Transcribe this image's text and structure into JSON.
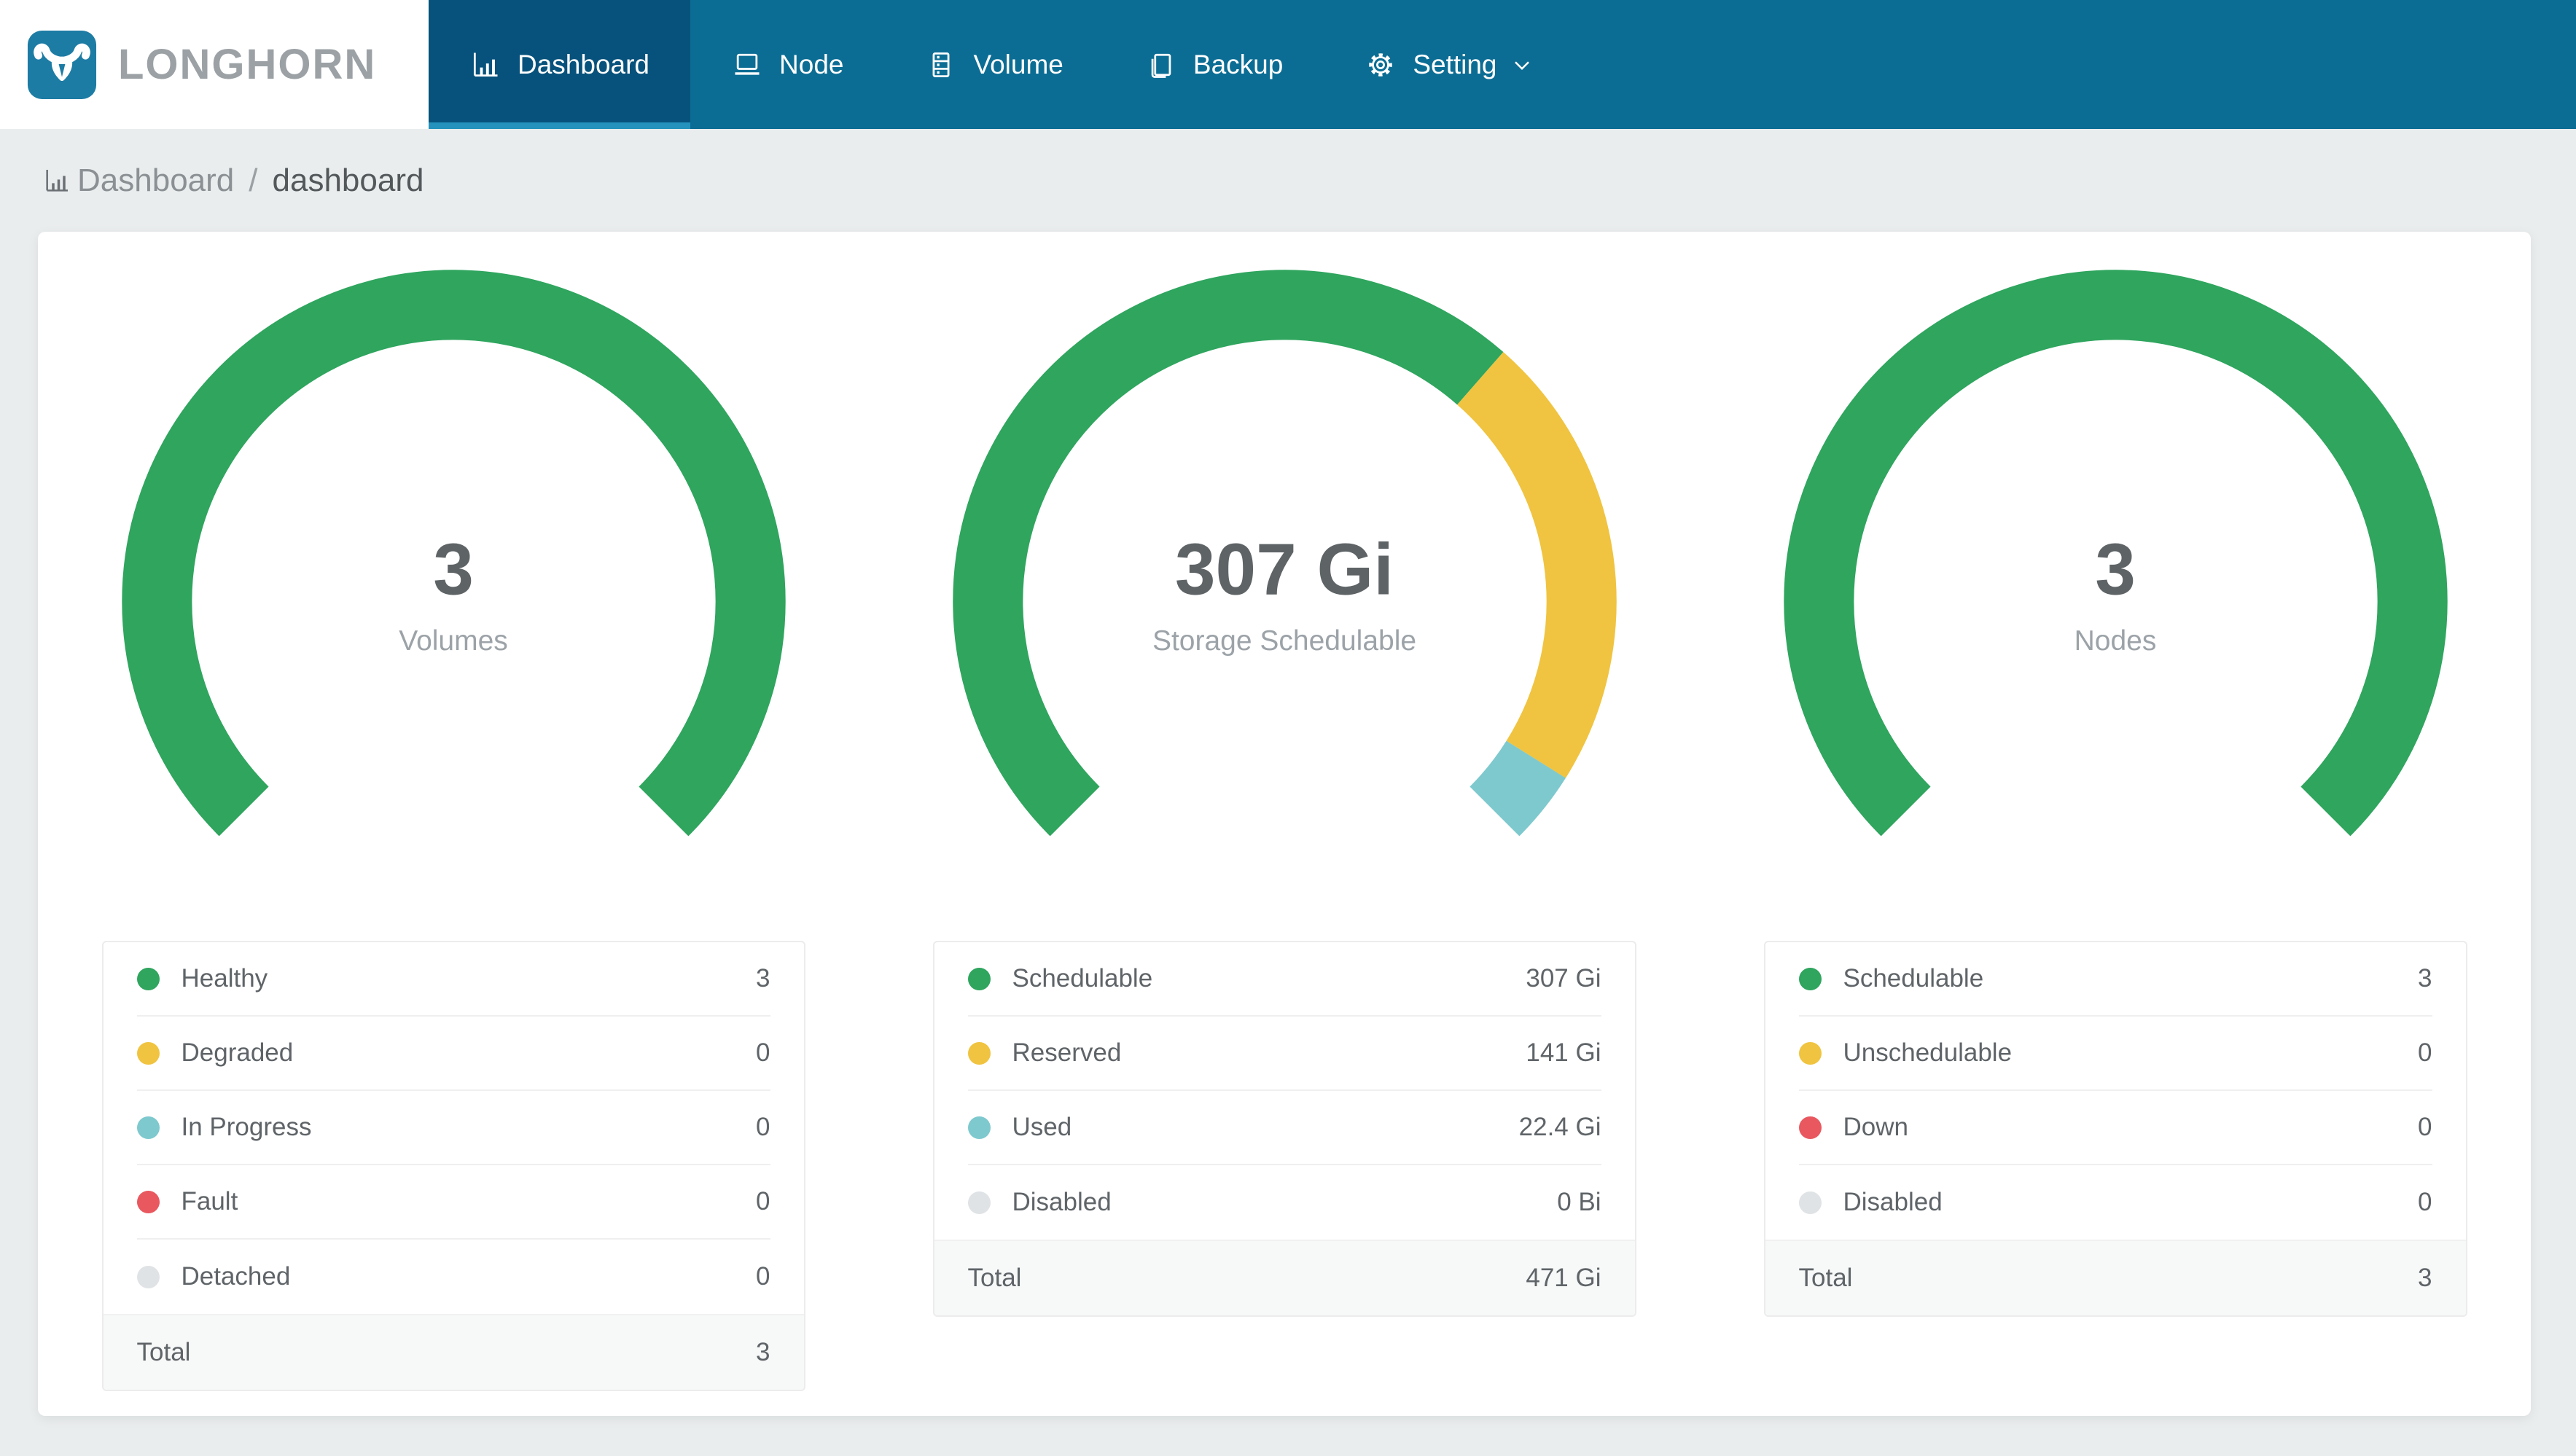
{
  "brand": {
    "name": "LONGHORN"
  },
  "nav": {
    "items": [
      {
        "label": "Dashboard",
        "icon": "bar-chart-icon",
        "active": true,
        "has_caret": false
      },
      {
        "label": "Node",
        "icon": "laptop-icon",
        "active": false,
        "has_caret": false
      },
      {
        "label": "Volume",
        "icon": "database-icon",
        "active": false,
        "has_caret": false
      },
      {
        "label": "Backup",
        "icon": "copy-icon",
        "active": false,
        "has_caret": false
      },
      {
        "label": "Setting",
        "icon": "gear-icon",
        "active": false,
        "has_caret": true
      }
    ]
  },
  "breadcrumb": {
    "section": "Dashboard",
    "separator": "/",
    "page": "dashboard"
  },
  "colors": {
    "green": "#2fa55e",
    "yellow": "#f0c440",
    "teal": "#7ec9ce",
    "red": "#e9585f",
    "gray": "#e0e3e6",
    "navbar_bg": "#0c6d94",
    "navbar_active_bg": "#07527c",
    "navbar_active_indicator": "#2492bd",
    "logo_blue": "#1d7ca4",
    "page_bg": "#eaedee"
  },
  "chart_data": [
    {
      "type": "gauge",
      "title": "Volumes",
      "center_value": "3",
      "center_label": "Volumes",
      "start_angle": -135,
      "arc_degrees": 270,
      "segments": [
        {
          "label": "Healthy",
          "value": 3,
          "display": "3",
          "color": "green"
        },
        {
          "label": "Degraded",
          "value": 0,
          "display": "0",
          "color": "yellow"
        },
        {
          "label": "In Progress",
          "value": 0,
          "display": "0",
          "color": "teal"
        },
        {
          "label": "Fault",
          "value": 0,
          "display": "0",
          "color": "red"
        },
        {
          "label": "Detached",
          "value": 0,
          "display": "0",
          "color": "gray"
        }
      ],
      "total_label": "Total",
      "total_display": "3"
    },
    {
      "type": "gauge",
      "title": "Storage Schedulable",
      "center_value": "307 Gi",
      "center_label": "Storage Schedulable",
      "start_angle": -135,
      "arc_degrees": 270,
      "segments": [
        {
          "label": "Schedulable",
          "value": 307,
          "display": "307 Gi",
          "color": "green"
        },
        {
          "label": "Reserved",
          "value": 141,
          "display": "141 Gi",
          "color": "yellow"
        },
        {
          "label": "Used",
          "value": 22.4,
          "display": "22.4 Gi",
          "color": "teal"
        },
        {
          "label": "Disabled",
          "value": 0,
          "display": "0 Bi",
          "color": "gray"
        }
      ],
      "total_label": "Total",
      "total_display": "471 Gi"
    },
    {
      "type": "gauge",
      "title": "Nodes",
      "center_value": "3",
      "center_label": "Nodes",
      "start_angle": -135,
      "arc_degrees": 270,
      "segments": [
        {
          "label": "Schedulable",
          "value": 3,
          "display": "3",
          "color": "green"
        },
        {
          "label": "Unschedulable",
          "value": 0,
          "display": "0",
          "color": "yellow"
        },
        {
          "label": "Down",
          "value": 0,
          "display": "0",
          "color": "red"
        },
        {
          "label": "Disabled",
          "value": 0,
          "display": "0",
          "color": "gray"
        }
      ],
      "total_label": "Total",
      "total_display": "3"
    }
  ]
}
